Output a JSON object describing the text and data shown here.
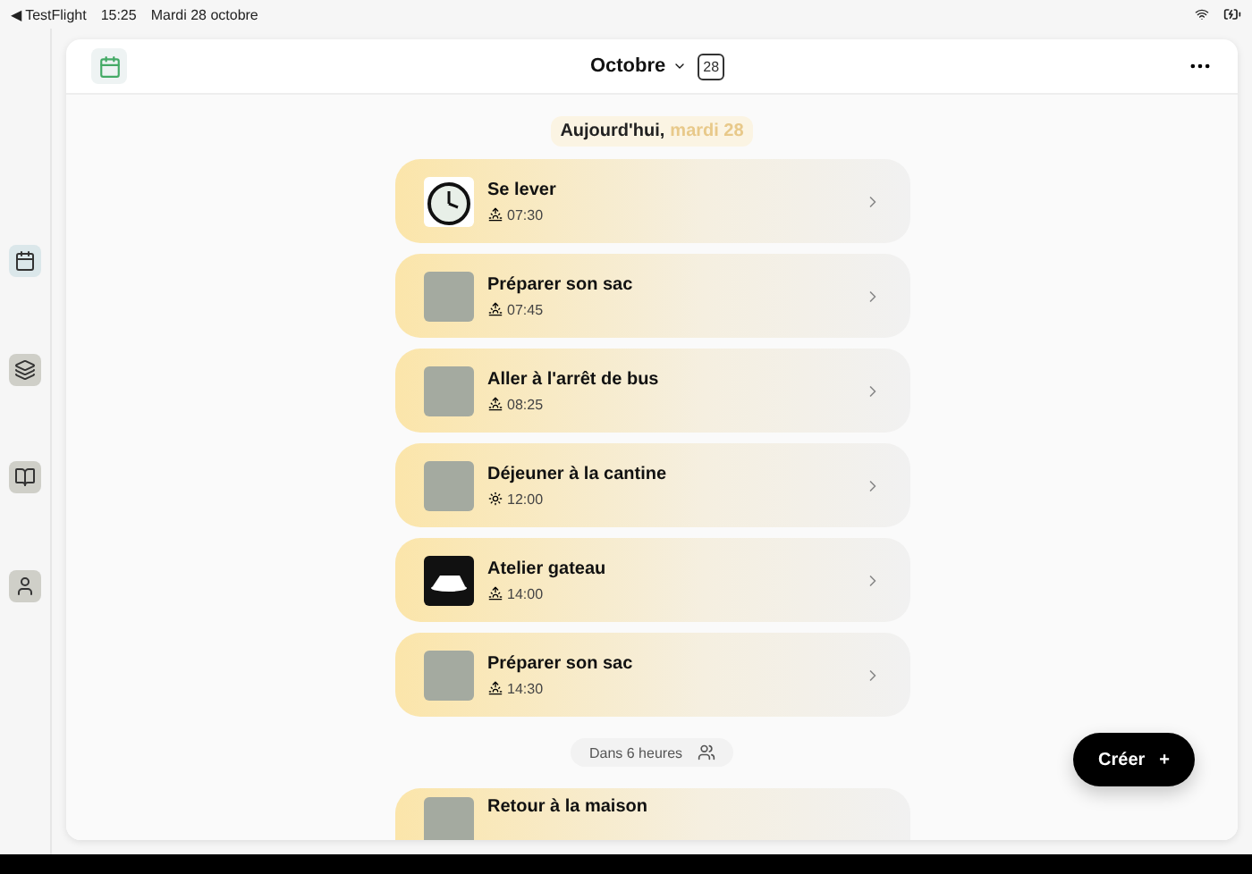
{
  "status_bar": {
    "back": "◀ TestFlight",
    "time": "15:25",
    "date": "Mardi 28 octobre"
  },
  "sidebar": {
    "items": [
      {
        "kind": "calendar",
        "selected": true
      },
      {
        "kind": "cards",
        "selected": false
      },
      {
        "kind": "book",
        "selected": false
      },
      {
        "kind": "profile",
        "selected": false
      }
    ]
  },
  "header": {
    "month": "Octobre",
    "day_badge": "28"
  },
  "day_heading": {
    "prefix": "Aujourd'hui,",
    "date": "mardi 28"
  },
  "events": [
    {
      "title": "Se lever",
      "time": "07:30",
      "thumbnail": {
        "kind": "clock"
      },
      "time_icon": {
        "kind": "sunrise"
      }
    },
    {
      "title": "Préparer son sac",
      "time": "07:45",
      "thumbnail": {
        "kind": "photo"
      },
      "time_icon": {
        "kind": "sunrise"
      }
    },
    {
      "title": "Aller à l'arrêt de bus",
      "time": "08:25",
      "thumbnail": {
        "kind": "photo"
      },
      "time_icon": {
        "kind": "sunrise"
      }
    },
    {
      "title": "Déjeuner à la cantine",
      "time": "12:00",
      "thumbnail": {
        "kind": "photo"
      },
      "time_icon": {
        "kind": "sun"
      }
    },
    {
      "title": "Atelier gateau",
      "time": "14:00",
      "thumbnail": {
        "kind": "cake"
      },
      "time_icon": {
        "kind": "sunrise"
      }
    },
    {
      "title": "Préparer son sac",
      "time": "14:30",
      "thumbnail": {
        "kind": "photo"
      },
      "time_icon": {
        "kind": "sunrise"
      }
    }
  ],
  "separator": {
    "label": "Dans 6 heures"
  },
  "next_events": [
    {
      "title": "Retour à la maison",
      "thumbnail": {
        "kind": "photo"
      }
    }
  ],
  "create_button": {
    "label": "Créer",
    "icon": "+"
  }
}
